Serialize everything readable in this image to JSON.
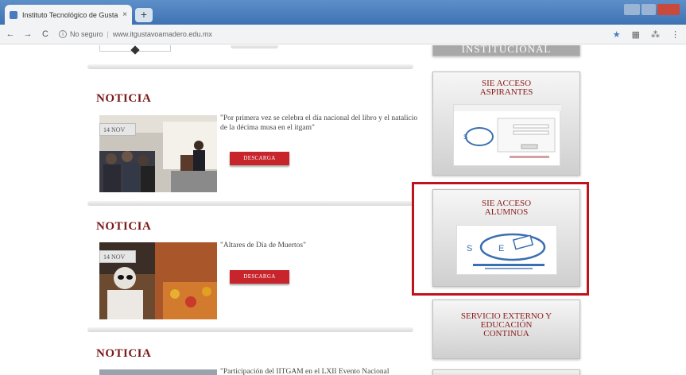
{
  "browser": {
    "tab_title": "Instituto Tecnológico de Gusta",
    "tab_close": "×",
    "new_tab": "+",
    "back": "←",
    "forward": "→",
    "reload": "C",
    "security_label": "No seguro",
    "url": "www.itgustavoamadero.edu.mx",
    "bookmark": "★",
    "ext_icon": "▦",
    "ext_icon2": "⁂",
    "menu": "⋮"
  },
  "news": [
    {
      "heading": "NOTICIA",
      "date": "14 NOV",
      "text": "\"Por primera vez se celebra el día nacional del libro y el natalicio de la décima musa en el itgam\"",
      "button": "DESCARGA"
    },
    {
      "heading": "NOTICIA",
      "date": "14 NOV",
      "text": "\"Altares de Día de Muertos\"",
      "button": "DESCARGA"
    },
    {
      "heading": "NOTICIA",
      "text": "\"Participación del IITGAM en el LXII Evento Nacional"
    }
  ],
  "sidebar": {
    "institucional": "INSTITUCIONAL",
    "aspirantes_title_1": "SIE ACCESO",
    "aspirantes_title_2": "ASPIRANTES",
    "alumnos_title_1": "SIE ACCESO",
    "alumnos_title_2": "ALUMNOS",
    "servicio_1": "SERVICIO EXTERNO Y",
    "servicio_2": "EDUCACIÓN",
    "servicio_3": "CONTINUA"
  },
  "colors": {
    "accent": "#c8242b",
    "heading": "#7a1a1a",
    "highlight": "#c0121b"
  }
}
